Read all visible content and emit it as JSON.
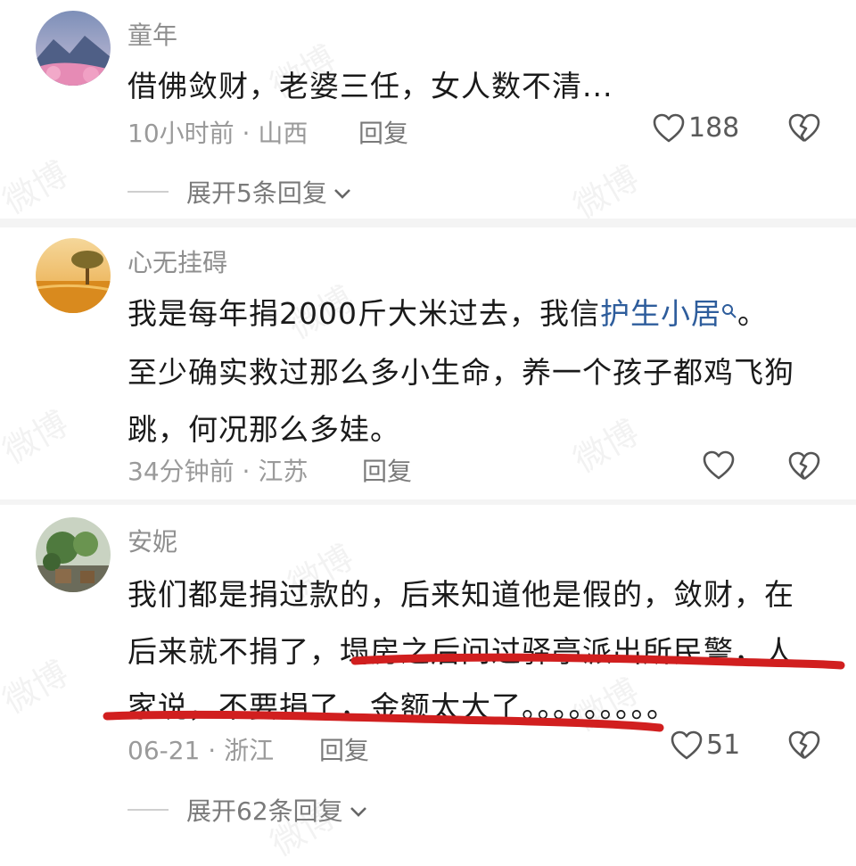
{
  "watermark": "微博",
  "comments": [
    {
      "user": "童年",
      "lines": [
        "借佛敛财，老婆三任，女人数不清..."
      ],
      "time": "10小时前",
      "location": "山西",
      "reply_label": "回复",
      "likes": "188",
      "expand_label": "展开5条回复"
    },
    {
      "user": "心无挂碍",
      "line1_before": "我是每年捐2000斤大米过去，我信",
      "line1_link": "护生小居",
      "line1_after": "。",
      "line2": "至少确实救过那么多小生命，养一个孩子都鸡飞狗",
      "line3": "跳，何况那么多娃。",
      "time": "34分钟前",
      "location": "江苏",
      "reply_label": "回复"
    },
    {
      "user": "安妮",
      "line1": "我们都是捐过款的，后来知道他是假的，敛财，在",
      "line2": "后来就不捐了，塌房之后问过驿亭派出所民警，人",
      "line3": "家说，不要捐了，金额太大了。。。。。。。。。",
      "time": "06-21",
      "location": "浙江",
      "reply_label": "回复",
      "likes": "51",
      "expand_label": "展开62条回复"
    }
  ],
  "colors": {
    "link": "#2e5d9c",
    "annotation": "#d11f1f"
  }
}
